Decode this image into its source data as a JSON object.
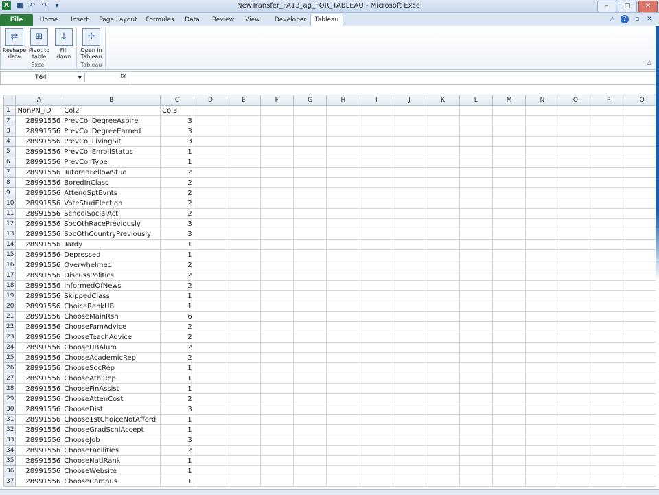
{
  "window": {
    "title": "NewTransfer_FA13_ag_FOR_TABLEAU - Microsoft Excel",
    "app_icon": "X",
    "quick_access": [
      {
        "name": "save-icon",
        "glyph": "■"
      },
      {
        "name": "undo-icon",
        "glyph": "↶"
      },
      {
        "name": "redo-icon",
        "glyph": "↷"
      },
      {
        "name": "customize-qat-icon",
        "glyph": "▾"
      }
    ],
    "controls": {
      "minimize": "–",
      "maximize": "□",
      "close": "✕"
    }
  },
  "tabs": [
    {
      "label": "File",
      "style": "file"
    },
    {
      "label": "Home",
      "style": ""
    },
    {
      "label": "Insert",
      "style": ""
    },
    {
      "label": "Page Layout",
      "style": ""
    },
    {
      "label": "Formulas",
      "style": ""
    },
    {
      "label": "Data",
      "style": ""
    },
    {
      "label": "Review",
      "style": ""
    },
    {
      "label": "View",
      "style": ""
    },
    {
      "label": "Developer",
      "style": ""
    },
    {
      "label": "Tableau",
      "style": "active"
    }
  ],
  "ribbon": {
    "buttons": [
      {
        "label1": "Reshape",
        "label2": "data",
        "icon": "reshape-data-icon",
        "glyph": "⇄"
      },
      {
        "label1": "Pivot to",
        "label2": "table",
        "icon": "pivot-table-icon",
        "glyph": "⊞"
      },
      {
        "label1": "Fill",
        "label2": "down",
        "icon": "fill-down-icon",
        "glyph": "↓"
      },
      {
        "label1": "Open in",
        "label2": "Tableau",
        "icon": "tableau-icon",
        "glyph": "✢"
      }
    ],
    "groups": [
      "Excel",
      "Tableau"
    ]
  },
  "formula_bar": {
    "name_box": "T64",
    "fx": "fx",
    "formula": ""
  },
  "columns": [
    "A",
    "B",
    "C",
    "D",
    "E",
    "F",
    "G",
    "H",
    "I",
    "J",
    "K",
    "L",
    "M",
    "N",
    "O",
    "P",
    "Q"
  ],
  "rows": [
    [
      "1",
      "NonPN_ID",
      "Col2",
      "Col3"
    ],
    [
      "2",
      "28991556",
      "PrevCollDegreeAspire",
      "3"
    ],
    [
      "3",
      "28991556",
      "PrevCollDegreeEarned",
      "3"
    ],
    [
      "4",
      "28991556",
      "PrevCollLivingSit",
      "3"
    ],
    [
      "5",
      "28991556",
      "PrevCollEnrollStatus",
      "1"
    ],
    [
      "6",
      "28991556",
      "PrevCollType",
      "1"
    ],
    [
      "7",
      "28991556",
      "TutoredFellowStud",
      "2"
    ],
    [
      "8",
      "28991556",
      "BoredInClass",
      "2"
    ],
    [
      "9",
      "28991556",
      "AttendSptEvnts",
      "2"
    ],
    [
      "10",
      "28991556",
      "VoteStudElection",
      "2"
    ],
    [
      "11",
      "28991556",
      "SchoolSocialAct",
      "2"
    ],
    [
      "12",
      "28991556",
      "SocOthRacePreviously",
      "3"
    ],
    [
      "13",
      "28991556",
      "SocOthCountryPreviously",
      "3"
    ],
    [
      "14",
      "28991556",
      "Tardy",
      "1"
    ],
    [
      "15",
      "28991556",
      "Depressed",
      "1"
    ],
    [
      "16",
      "28991556",
      "Overwhelmed",
      "2"
    ],
    [
      "17",
      "28991556",
      "DiscussPolitics",
      "2"
    ],
    [
      "18",
      "28991556",
      "InformedOfNews",
      "2"
    ],
    [
      "19",
      "28991556",
      "SkippedClass",
      "1"
    ],
    [
      "20",
      "28991556",
      "ChoiceRankUB",
      "1"
    ],
    [
      "21",
      "28991556",
      "ChooseMainRsn",
      "6"
    ],
    [
      "22",
      "28991556",
      "ChooseFamAdvice",
      "2"
    ],
    [
      "23",
      "28991556",
      "ChooseTeachAdvice",
      "2"
    ],
    [
      "24",
      "28991556",
      "ChooseUBAlum",
      "2"
    ],
    [
      "25",
      "28991556",
      "ChooseAcademicRep",
      "2"
    ],
    [
      "26",
      "28991556",
      "ChooseSocRep",
      "1"
    ],
    [
      "27",
      "28991556",
      "ChooseAthlRep",
      "1"
    ],
    [
      "28",
      "28991556",
      "ChooseFinAssist",
      "1"
    ],
    [
      "29",
      "28991556",
      "ChooseAttenCost",
      "2"
    ],
    [
      "30",
      "28991556",
      "ChooseDist",
      "3"
    ],
    [
      "31",
      "28991556",
      "Choose1stChoiceNotAfford",
      "1"
    ],
    [
      "32",
      "28991556",
      "ChooseGradSchlAccept",
      "1"
    ],
    [
      "33",
      "28991556",
      "ChooseJob",
      "3"
    ],
    [
      "34",
      "28991556",
      "ChooseFacilities",
      "2"
    ],
    [
      "35",
      "28991556",
      "ChooseNatlRank",
      "1"
    ],
    [
      "36",
      "28991556",
      "ChooseWebsite",
      "1"
    ],
    [
      "37",
      "28991556",
      "ChooseCampus",
      "1"
    ]
  ]
}
